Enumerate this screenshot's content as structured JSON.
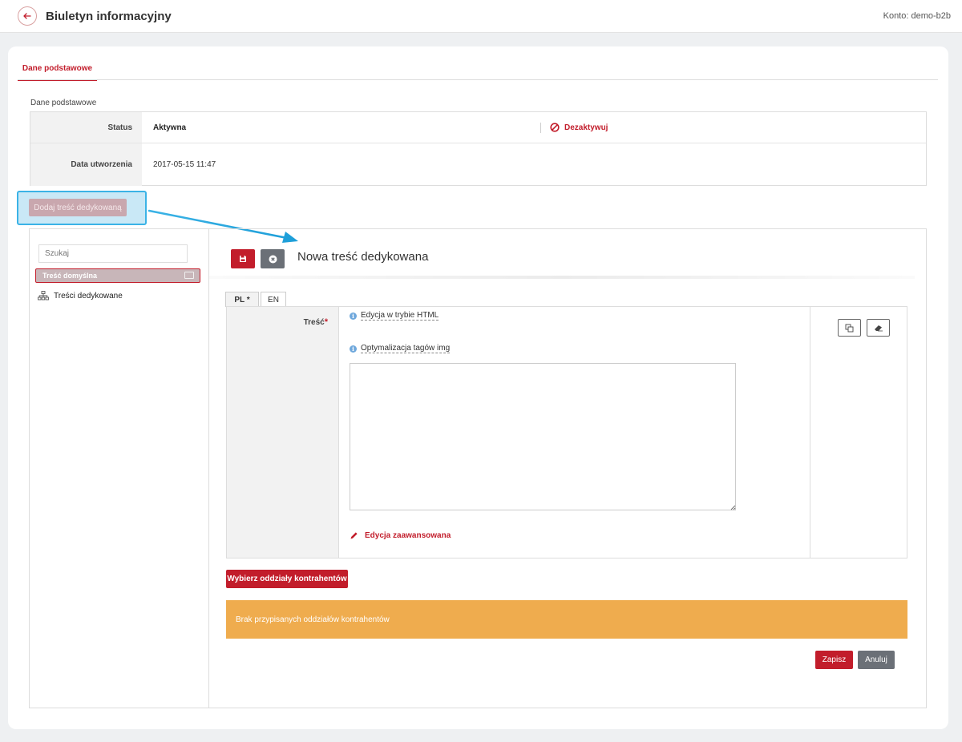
{
  "header": {
    "title": "Biuletyn informacyjny",
    "account": "Konto: demo-b2b",
    "back_icon": "arrow-left-icon"
  },
  "tabs": [
    {
      "label": "Dane podstawowe",
      "active": true
    }
  ],
  "basic_data": {
    "section_label": "Dane podstawowe",
    "rows": [
      {
        "label": "Status",
        "value": "Aktywna"
      },
      {
        "label": "Data utworzenia",
        "value": "2017-05-15 11:47"
      }
    ],
    "deactivate_label": "Dezaktywuj"
  },
  "add_button": {
    "label": "Dodaj treść dedykowaną"
  },
  "tree": {
    "search_placeholder": "Szukaj",
    "default_item": "Treść domyślna",
    "dedicated_item": "Treści dedykowane"
  },
  "form": {
    "title": "Nowa treść dedykowana",
    "lang_tabs": [
      {
        "label": "PL *",
        "active": true
      },
      {
        "label": "EN",
        "active": false
      }
    ],
    "content_label": "Treść",
    "required_mark": "*",
    "html_mode_link": "Edycja w trybie HTML",
    "img_opt_link": "Optymalizacja tagów img",
    "editor_value": "",
    "advanced_edit": "Edycja zaawansowana",
    "branches_button": "Wybierz oddziały kontrahentów",
    "alert_text": "Brak przypisanych oddziałów kontrahentów",
    "save_label": "Zapisz",
    "cancel_label": "Anuluj"
  },
  "colors": {
    "accent": "#c21d2b",
    "warning": "#efac4e",
    "highlight": "#3bb3e6",
    "secondary": "#6b7077"
  }
}
